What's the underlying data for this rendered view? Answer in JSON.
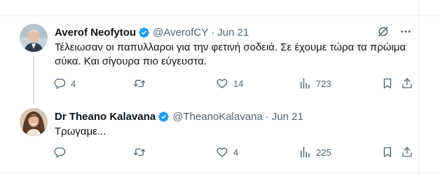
{
  "tweets": [
    {
      "name": "Averof Neofytou",
      "handle": "@AverofCY",
      "separator": "·",
      "time": "Jun 21",
      "text": "Τέλειωσαν οι παπυλλαροι για την φετινή σοδειά. Σε έχουμε τώρα τα πρώιμα σύκα. Και σίγουρα πιο εύγευστα.",
      "replies": "4",
      "retweets": "",
      "likes": "14",
      "views": "723"
    },
    {
      "name": "Dr Theano Kalavana",
      "handle": "@TheanoKalavana",
      "separator": "·",
      "time": "Jun 21",
      "text": "Τρωγαμε...",
      "replies": "",
      "retweets": "",
      "likes": "4",
      "views": "225"
    }
  ],
  "icons": {
    "verified": "verified-badge-icon",
    "grok": "grok-icon",
    "more": "more-icon",
    "reply": "reply-icon",
    "retweet": "retweet-icon",
    "like": "heart-icon",
    "views": "views-icon",
    "bookmark": "bookmark-icon",
    "share": "share-icon"
  },
  "colors": {
    "verified": "#1d9bf0",
    "muted": "#536471",
    "text": "#0f1419"
  }
}
